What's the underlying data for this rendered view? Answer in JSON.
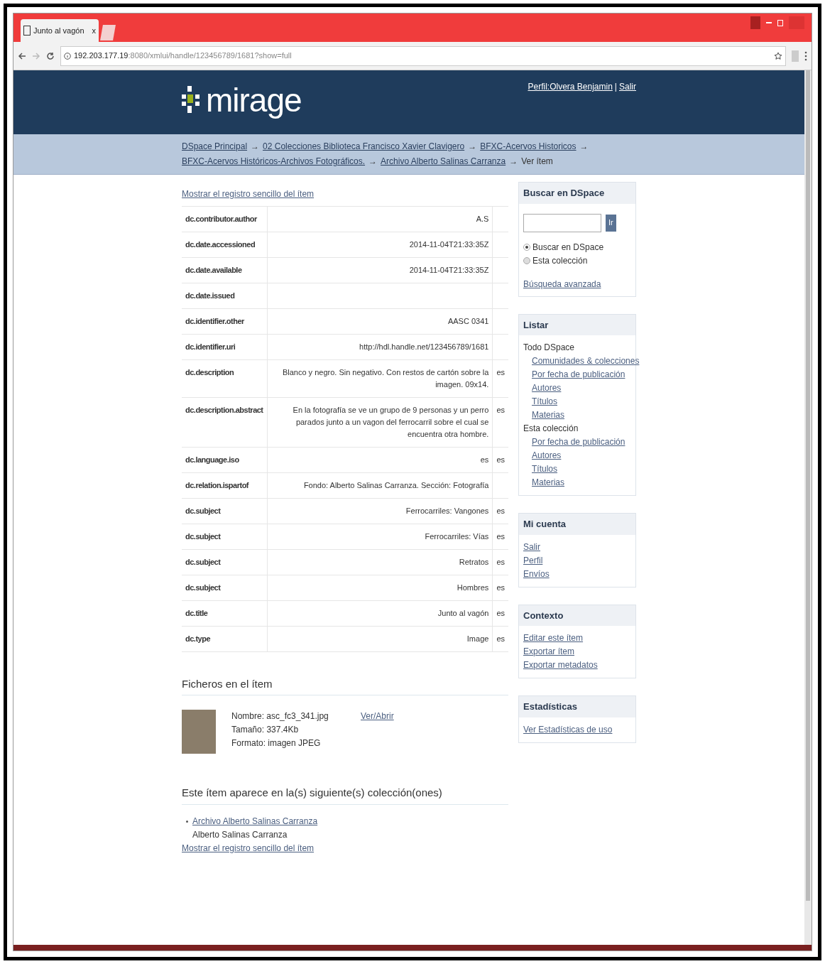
{
  "browser": {
    "tab_title": "Junto al vagón",
    "tab_close": "x",
    "url_host": "192.203.177.19",
    "url_path": ":8080/xmlui/handle/123456789/1681?show=full"
  },
  "header": {
    "logo_text": "mirage",
    "user_link": "Perfil:Olvera Benjamin",
    "separator": "|",
    "logout_link": "Salir"
  },
  "breadcrumbs": [
    {
      "kind": "link",
      "text": "DSpace Principal"
    },
    {
      "kind": "arrow",
      "text": "→"
    },
    {
      "kind": "link",
      "text": "02 Colecciones Biblioteca Francisco Xavier Clavigero"
    },
    {
      "kind": "arrow",
      "text": "→"
    },
    {
      "kind": "link",
      "text": "BFXC-Acervos Historicos"
    },
    {
      "kind": "arrow",
      "text": "→"
    },
    {
      "kind": "link",
      "text": "BFXC-Acervos Históricos-Archivos Fotográficos."
    },
    {
      "kind": "arrow",
      "text": "→"
    },
    {
      "kind": "link",
      "text": "Archivo Alberto Salinas Carranza"
    },
    {
      "kind": "arrow",
      "text": "→"
    },
    {
      "kind": "plain",
      "text": "Ver ítem"
    }
  ],
  "top_link": "Mostrar el registro sencillo del ítem",
  "metadata": [
    {
      "field": "dc.contributor.author",
      "value": "A.S"
    },
    {
      "field": "dc.date.accessioned",
      "value": "2014-11-04T21:33:35Z"
    },
    {
      "field": "dc.date.available",
      "value": "2014-11-04T21:33:35Z"
    },
    {
      "field": "dc.date.issued"
    },
    {
      "field": "dc.identifier.other",
      "value": "AASC 0341"
    },
    {
      "field": "dc.identifier.uri",
      "value": "http://hdl.handle.net/123456789/1681"
    },
    {
      "field": "dc.description",
      "value": "Blanco y negro. Sin negativo. Con restos de cartón sobre la imagen. 09x14.",
      "lang": "es"
    },
    {
      "field": "dc.description.abstract",
      "value": "En la fotografía se ve un grupo de 9 personas y un perro parados junto a un vagon del ferrocarril sobre el cual se encuentra otra hombre.",
      "lang": "es"
    },
    {
      "field": "dc.language.iso",
      "value": "es",
      "lang": "es"
    },
    {
      "field": "dc.relation.ispartof",
      "value": "Fondo: Alberto Salinas Carranza. Sección: Fotografía"
    },
    {
      "field": "dc.subject",
      "value": "Ferrocarriles: Vangones",
      "lang": "es"
    },
    {
      "field": "dc.subject",
      "value": "Ferrocarriles: Vías",
      "lang": "es"
    },
    {
      "field": "dc.subject",
      "value": "Retratos",
      "lang": "es"
    },
    {
      "field": "dc.subject",
      "value": "Hombres",
      "lang": "es"
    },
    {
      "field": "dc.title",
      "value": "Junto al vagón",
      "lang": "es"
    },
    {
      "field": "dc.type",
      "value": "Image",
      "lang": "es"
    }
  ],
  "files": {
    "heading": "Ficheros en el ítem",
    "items": [
      {
        "fields": [
          {
            "label": "Nombre:",
            "value": "asc_fc3_341.jpg"
          },
          {
            "label": "Tamaño:",
            "value": "337.4Kb"
          },
          {
            "label": "Formato:",
            "value": "imagen JPEG"
          }
        ],
        "link": "Ver/Abrir"
      }
    ]
  },
  "collections": {
    "heading": "Este ítem aparece en la(s) siguiente(s) colección(ones)",
    "items": [
      {
        "link": "Archivo Alberto Salinas Carranza",
        "description": "Alberto Salinas Carranza"
      }
    ],
    "bottom_link": "Mostrar el registro sencillo del ítem"
  },
  "sidebar": {
    "search": {
      "title": "Buscar en DSpace",
      "button": "Ir",
      "scopes": [
        {
          "label": "Buscar en DSpace",
          "selected": true
        },
        {
          "label": "Esta colección",
          "selected": false
        }
      ],
      "advanced_link": "Búsqueda avanzada"
    },
    "browse": {
      "title": "Listar",
      "groups": [
        {
          "label": "Todo DSpace",
          "children": [
            "Comunidades & colecciones",
            "Por fecha de publicación",
            "Autores",
            "Títulos",
            "Materias"
          ]
        },
        {
          "label": "Esta colección",
          "children": [
            "Por fecha de publicación",
            "Autores",
            "Títulos",
            "Materias"
          ]
        }
      ]
    },
    "panels": [
      {
        "title": "Mi cuenta",
        "links": [
          "Salir",
          "Perfil",
          "Envíos"
        ]
      },
      {
        "title": "Contexto",
        "links": [
          "Editar este ítem",
          "Exportar ítem",
          "Exportar metadatos"
        ]
      },
      {
        "title": "Estadísticas",
        "links": [
          "Ver Estadísticas de uso"
        ]
      }
    ]
  }
}
